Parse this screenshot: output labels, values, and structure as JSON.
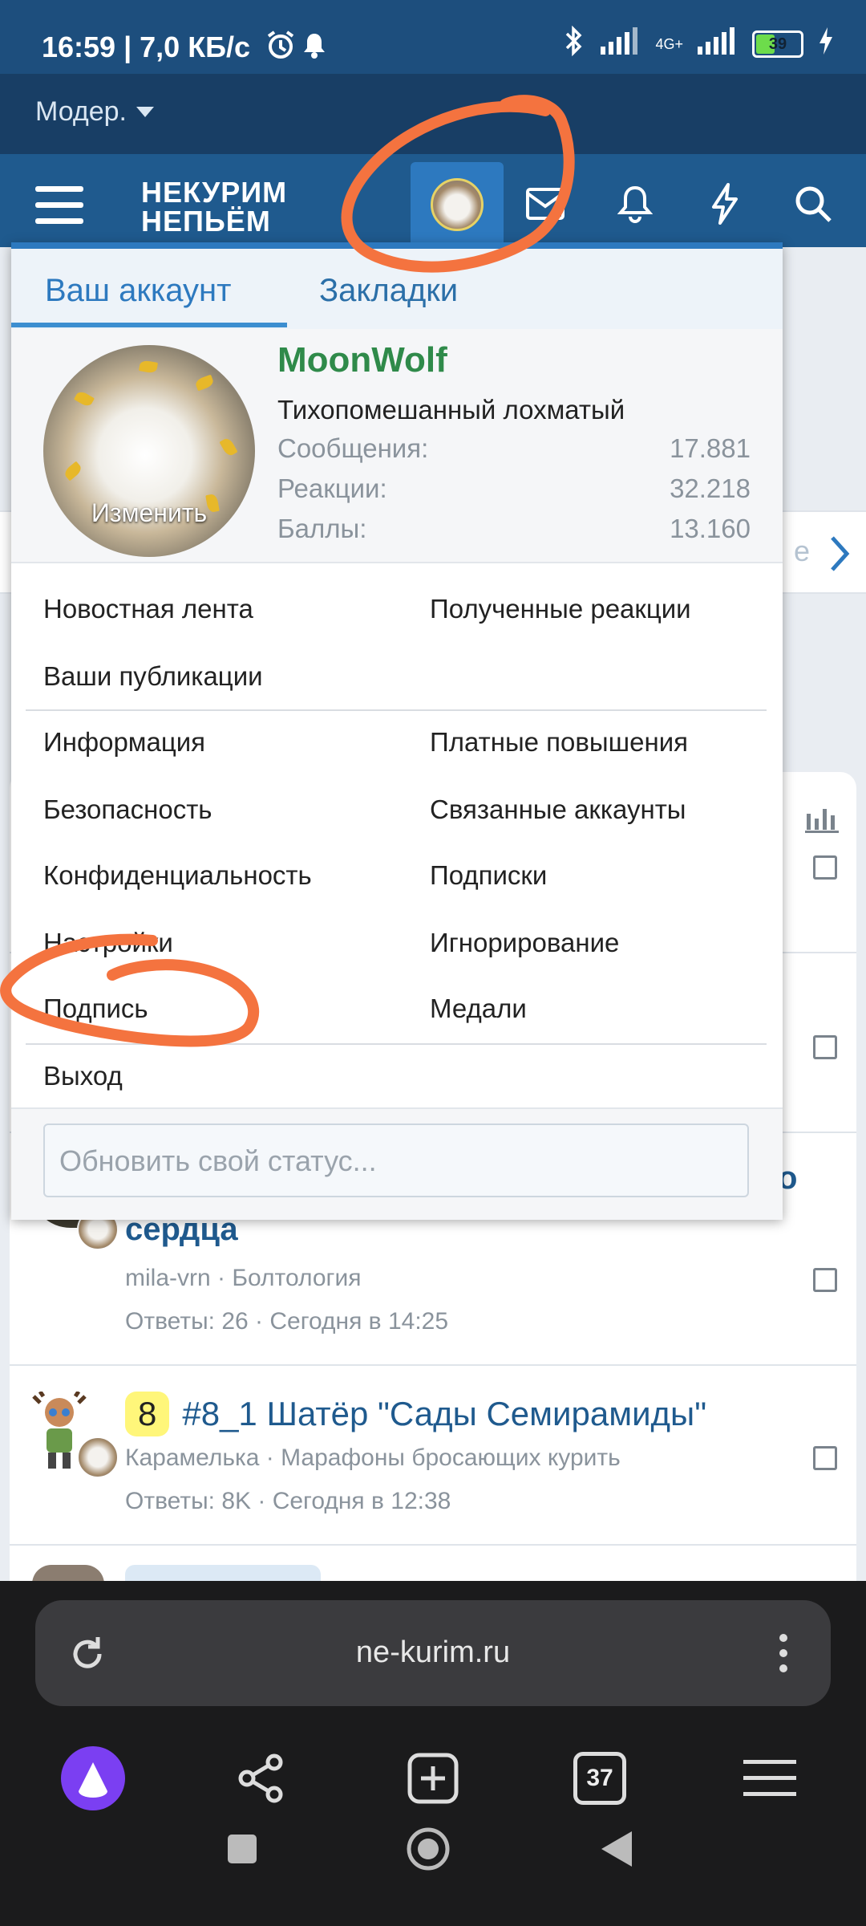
{
  "statusbar": {
    "time": "16:59 | 7,0 КБ/с",
    "network": "4G+",
    "battery": "39"
  },
  "modbar": {
    "label": "Модер."
  },
  "header": {
    "logo_line1": "НЕКУРИМ",
    "logo_line2": "НЕПЬЁМ"
  },
  "popup": {
    "tabs": [
      "Ваш аккаунт",
      "Закладки"
    ],
    "avatar_action": "Изменить",
    "username": "MoonWolf",
    "user_title": "Тихопомешанный лохматый",
    "stats": [
      {
        "label": "Сообщения:",
        "value": "17.881"
      },
      {
        "label": "Реакции:",
        "value": "32.218"
      },
      {
        "label": "Баллы:",
        "value": "13.160"
      }
    ],
    "menu1": [
      "Новостная лента",
      "Полученные реакции",
      "Ваши публикации"
    ],
    "menu2": [
      "Информация",
      "Платные повышения",
      "Безопасность",
      "Связанные аккаунты",
      "Конфиденциальность",
      "Подписки",
      "Настройки",
      "Игнорирование",
      "Подпись",
      "Медали"
    ],
    "logout": "Выход",
    "status_placeholder": "Обновить свой статус..."
  },
  "background": {
    "thread1": {
      "title_tail": "сердца",
      "title_fragment": "о",
      "author": "mila-vrn · Болтология",
      "meta": "Ответы: 26 · Сегодня в 14:25"
    },
    "thread2": {
      "prefix": "8",
      "title": "#8_1 Шатёр \"Сады Семирамиды\"",
      "author": "Карамелька · Марафоны бросающих курить",
      "meta": "Ответы: 8K · Сегодня в 12:38"
    },
    "side_fragment": "е"
  },
  "browser": {
    "url": "ne-kurim.ru",
    "tab_count": "37"
  },
  "colors": {
    "header": "#1f5a8e",
    "accent": "#2d79bf",
    "username": "#2f8a4a",
    "annotation": "#f4733f"
  }
}
